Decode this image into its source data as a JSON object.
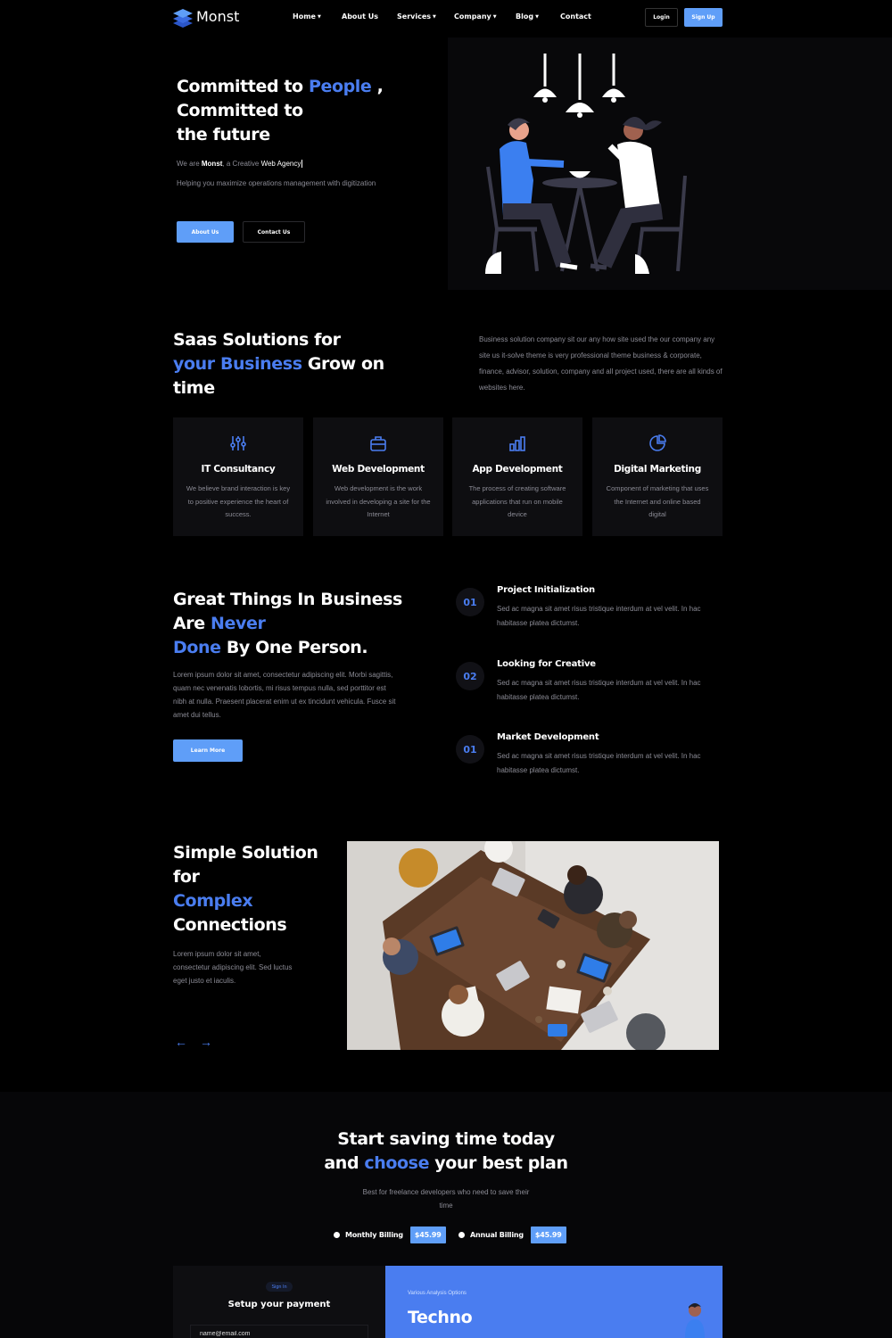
{
  "nav": {
    "logo": "Monst",
    "items": [
      {
        "label": "Home",
        "caret": true
      },
      {
        "label": "About Us",
        "caret": false
      },
      {
        "label": "Services",
        "caret": true
      },
      {
        "label": "Company",
        "caret": true
      },
      {
        "label": "Blog",
        "caret": true
      },
      {
        "label": "Contact",
        "caret": false
      }
    ],
    "login": "Login",
    "signup": "Sign Up"
  },
  "hero": {
    "title_a": "Committed to ",
    "title_highlight": "People",
    "title_b": " ,",
    "title_c": "Committed to the future",
    "sub_a": "We are ",
    "sub_brand": "Monst",
    "sub_b": ", a Creative ",
    "sub_c": "Web Agency",
    "desc": "Helping you maximize operations management with digitization",
    "btn_about": "About Us",
    "btn_contact": "Contact Us"
  },
  "saas": {
    "title_a": "Saas Solutions for",
    "title_highlight": "your Business",
    "title_b": " Grow on time",
    "desc": "Business solution company sit our any how site used the our company any site us it-solve theme is very professional theme business & corporate, finance, advisor, solution, company and all project used, there are all kinds of websites here.",
    "cards": [
      {
        "icon": "sliders-icon",
        "title": "IT Consultancy",
        "desc": "We believe brand interaction is key to positive experience the heart of success."
      },
      {
        "icon": "briefcase-icon",
        "title": "Web Development",
        "desc": "Web development is the work involved in developing a site for the Internet"
      },
      {
        "icon": "bar-chart-icon",
        "title": "App Development",
        "desc": "The process of creating software applications that run on mobile device"
      },
      {
        "icon": "pie-chart-icon",
        "title": "Digital Marketing",
        "desc": "Component of marketing that uses the Internet and online based digital"
      }
    ]
  },
  "great": {
    "title_a": "Great Things In Business Are ",
    "title_highlight1": "Never",
    "title_highlight2": "Done",
    "title_b": " By One Person.",
    "desc": "Lorem ipsum dolor sit amet, consectetur adipiscing elit. Morbi sagittis, quam nec venenatis lobortis, mi risus tempus nulla, sed porttitor est nibh at nulla. Praesent placerat enim ut ex tincidunt vehicula. Fusce sit amet dui tellus.",
    "btn": "Learn More",
    "steps": [
      {
        "num": "01",
        "title": "Project Initialization",
        "desc": "Sed ac magna sit amet risus tristique interdum at vel velit. In hac habitasse platea dictumst."
      },
      {
        "num": "02",
        "title": "Looking for Creative",
        "desc": "Sed ac magna sit amet risus tristique interdum at vel velit. In hac habitasse platea dictumst."
      },
      {
        "num": "01",
        "title": "Market Development",
        "desc": "Sed ac magna sit amet risus tristique interdum at vel velit. In hac habitasse platea dictumst."
      }
    ]
  },
  "simple": {
    "title_a": "Simple Solution for",
    "title_highlight": "Complex",
    "title_b": "Connections",
    "desc": "Lorem ipsum dolor sit amet, consectetur adipiscing elit. Sed luctus eget justo et iaculis.",
    "prev": "←",
    "next": "→"
  },
  "pricing": {
    "title_a": "Start saving time today",
    "title_b": "and ",
    "title_highlight": "choose",
    "title_c": " your best plan",
    "desc": "Best for freelance developers who need to save their time",
    "monthly_label": "Monthly Billing",
    "monthly_price": "$45.99",
    "annual_label": "Annual Billing",
    "annual_price": "$45.99",
    "signin_tag": "Sign In",
    "pay_title": "Setup your payment",
    "email_value": "name@email.com",
    "blue_small": "Various Analysis Options",
    "blue_title": "Techno"
  },
  "colors": {
    "accent": "#4a7df0",
    "button": "#5f9ef8",
    "background": "#000000"
  }
}
